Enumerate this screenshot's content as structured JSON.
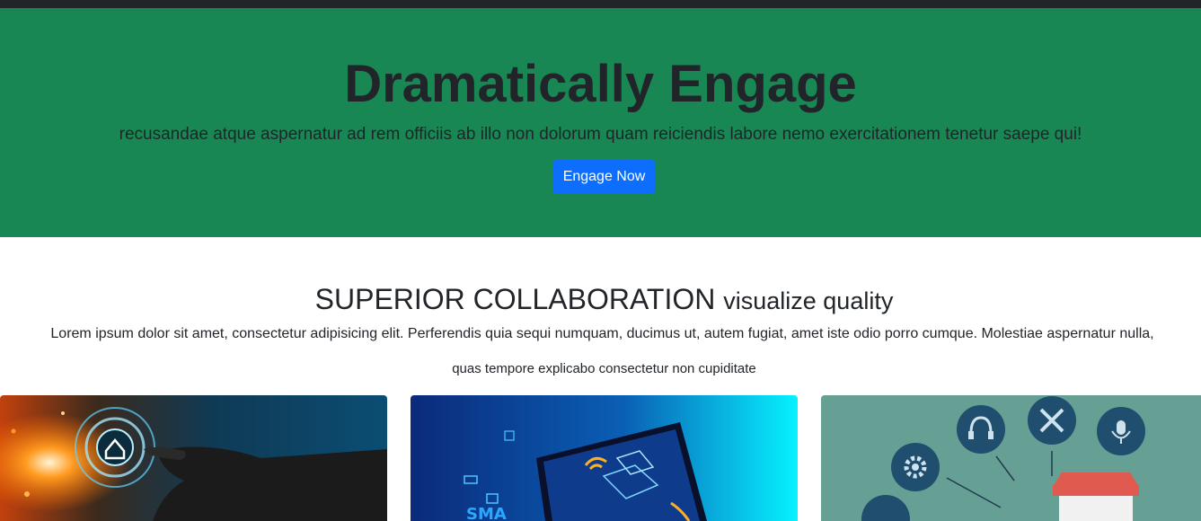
{
  "hero": {
    "title": "Dramatically Engage",
    "subtitle": "recusandae atque aspernatur ad rem officiis ab illo non dolorum quam reiciendis labore nemo exercitationem tenetur saepe qui!",
    "button_label": "Engage Now"
  },
  "section": {
    "title_main": "SUPERIOR COLLABORATION",
    "title_small": "visualize quality",
    "paragraph_line1": "Lorem ipsum dolor sit amet, consectetur adipisicing elit. Perferendis quia sequi numquam, ducimus ut, autem fugiat, amet iste odio porro cumque. Molestiae aspernatur nulla,",
    "paragraph_line2": "quas tempore explicabo consectetur non cupiditate"
  },
  "cards": [
    {
      "image": "smart-home-hand-touch-image"
    },
    {
      "image": "smartphone-smart-home-image"
    },
    {
      "image": "smart-home-icons-image"
    }
  ],
  "colors": {
    "hero_bg": "#198754",
    "button_bg": "#0d6efd",
    "text": "#212529",
    "topbar": "#212529"
  }
}
